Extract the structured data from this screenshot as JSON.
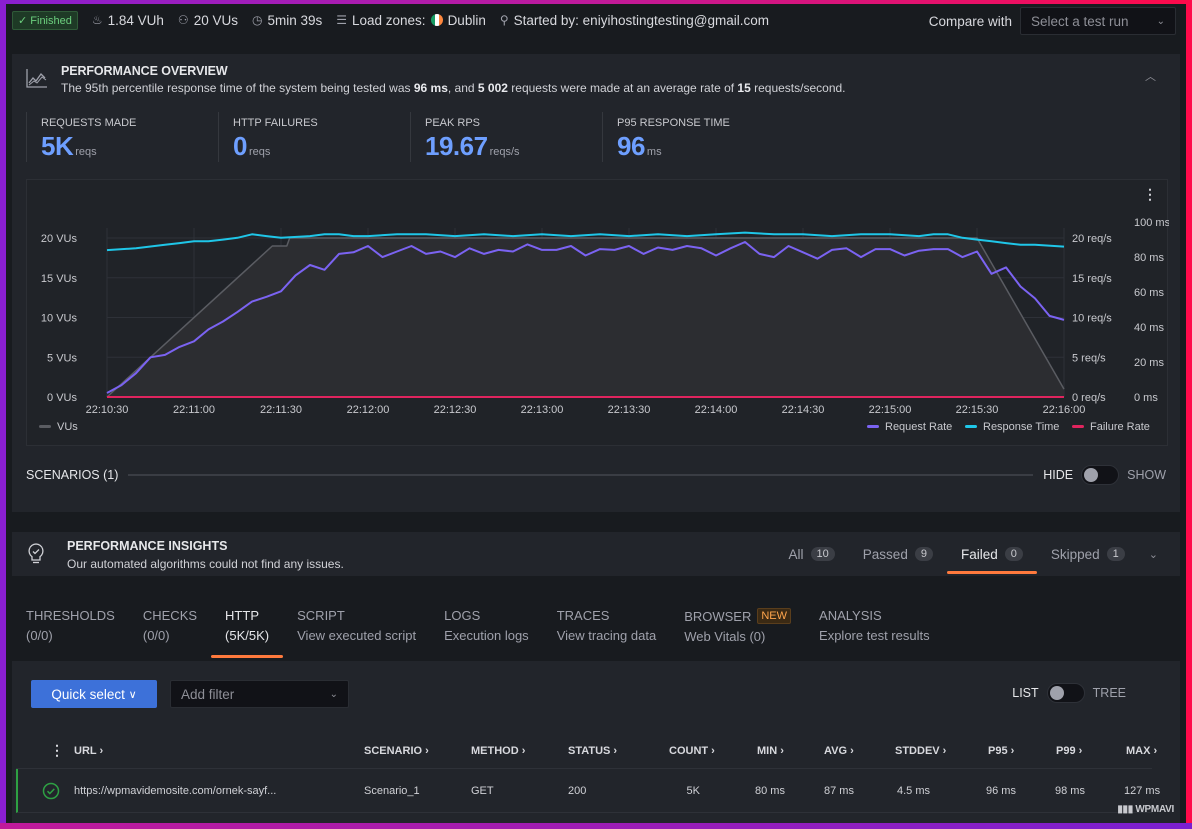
{
  "topbar": {
    "status": "Finished",
    "vuh": "1.84 VUh",
    "vus": "20 VUs",
    "duration": "5min 39s",
    "load_zones_label": "Load zones:",
    "load_zone": "Dublin",
    "started_by": "Started by: eniyihostingtesting@gmail.com",
    "compare_label": "Compare with",
    "compare_placeholder": "Select a test run"
  },
  "overview": {
    "title": "PERFORMANCE OVERVIEW",
    "desc_pre": "The 95th percentile response time of the system being tested was ",
    "desc_p95": "96 ms",
    "desc_mid": ", and ",
    "desc_requests": "5 002",
    "desc_mid2": " requests were made at an average rate of ",
    "desc_rate": "15",
    "desc_post": " requests/second.",
    "stats": [
      {
        "label": "REQUESTS MADE",
        "value": "5K",
        "unit": "reqs"
      },
      {
        "label": "HTTP FAILURES",
        "value": "0",
        "unit": "reqs"
      },
      {
        "label": "PEAK RPS",
        "value": "19.67",
        "unit": "reqs/s"
      },
      {
        "label": "P95 RESPONSE TIME",
        "value": "96",
        "unit": "ms"
      }
    ]
  },
  "chart_data": {
    "type": "line",
    "title": "",
    "x_ticks": [
      "22:10:30",
      "22:11:00",
      "22:11:30",
      "22:12:00",
      "22:12:30",
      "22:13:00",
      "22:13:30",
      "22:14:00",
      "22:14:30",
      "22:15:00",
      "22:15:30",
      "22:16:00"
    ],
    "x_range_seconds": [
      0,
      330
    ],
    "y_left": {
      "label": "VUs",
      "ticks": [
        "0 VUs",
        "5 VUs",
        "10 VUs",
        "15 VUs",
        "20 VUs"
      ],
      "range": [
        0,
        20
      ]
    },
    "y_right_rps": {
      "ticks": [
        "0 req/s",
        "5 req/s",
        "10 req/s",
        "15 req/s",
        "20 req/s"
      ],
      "range": [
        0,
        20
      ]
    },
    "y_right_ms": {
      "ticks": [
        "0 ms",
        "20 ms",
        "40 ms",
        "60 ms",
        "80 ms",
        "100 ms"
      ],
      "range": [
        0,
        100
      ]
    },
    "grid": true,
    "legend_left": [
      "VUs"
    ],
    "legend_right": [
      "Request Rate",
      "Response Time",
      "Failure Rate"
    ],
    "colors": {
      "vus": "#5a5c62",
      "request_rate": "#7b63f2",
      "response_time": "#1fc6e8",
      "failure_rate": "#e0245e"
    },
    "series": [
      {
        "name": "VUs",
        "axis": "vus",
        "x": [
          0,
          57,
          62,
          63,
          300,
          330
        ],
        "values": [
          0,
          19,
          19,
          20,
          20,
          1
        ]
      },
      {
        "name": "Request Rate",
        "axis": "rps",
        "x": [
          0,
          5,
          10,
          15,
          20,
          25,
          30,
          35,
          40,
          45,
          50,
          55,
          60,
          65,
          70,
          75,
          80,
          85,
          90,
          95,
          100,
          105,
          110,
          115,
          120,
          125,
          130,
          135,
          140,
          145,
          150,
          155,
          160,
          165,
          170,
          175,
          180,
          185,
          190,
          195,
          200,
          205,
          210,
          215,
          220,
          225,
          230,
          235,
          240,
          245,
          250,
          255,
          260,
          265,
          270,
          275,
          280,
          285,
          290,
          295,
          300,
          305,
          310,
          315,
          320,
          325,
          330
        ],
        "values": [
          0.5,
          1.5,
          3,
          5,
          5.3,
          6.3,
          7,
          8.5,
          9.5,
          10.7,
          12,
          12.6,
          13.3,
          15.3,
          16.6,
          16,
          18,
          18.2,
          19,
          17.6,
          18.3,
          19,
          18,
          18.3,
          17.6,
          18.7,
          18,
          18.5,
          18.3,
          19.2,
          18.5,
          18.5,
          19,
          17.8,
          18.6,
          18.5,
          19,
          18,
          18.8,
          18.5,
          19,
          18.7,
          17.8,
          18.7,
          19.5,
          18,
          17.6,
          19,
          18.2,
          17.4,
          18.5,
          18.7,
          17.6,
          18.6,
          18.6,
          17.8,
          18.4,
          18.6,
          18.6,
          17.6,
          18.3,
          15.5,
          16.3,
          13.9,
          12.4,
          10.2,
          9.7,
          7.9,
          5.9,
          4.2,
          2.2,
          1
        ]
      },
      {
        "name": "Response Time",
        "axis": "ms",
        "x": [
          0,
          10,
          20,
          25,
          30,
          35,
          40,
          45,
          50,
          55,
          60,
          70,
          75,
          80,
          85,
          90,
          100,
          110,
          120,
          130,
          140,
          150,
          160,
          170,
          180,
          190,
          200,
          210,
          220,
          230,
          240,
          250,
          260,
          270,
          280,
          285,
          290,
          295,
          300,
          305,
          310,
          315,
          320,
          330
        ],
        "values": [
          84,
          85,
          87,
          88,
          89,
          89,
          90,
          91,
          93,
          92,
          91,
          92,
          93,
          93,
          92,
          92,
          93,
          93,
          92,
          93,
          92,
          93,
          92,
          93,
          92,
          93,
          92,
          93,
          94,
          93,
          93,
          92,
          93,
          93,
          92,
          93,
          93,
          91,
          90,
          89,
          88,
          87,
          87,
          86
        ]
      },
      {
        "name": "Failure Rate",
        "axis": "rps",
        "x": [
          0,
          330
        ],
        "values": [
          0,
          0
        ]
      }
    ]
  },
  "scenarios": {
    "label": "SCENARIOS (1)",
    "hide": "HIDE",
    "show": "SHOW"
  },
  "insights": {
    "title": "PERFORMANCE INSIGHTS",
    "desc": "Our automated algorithms could not find any issues.",
    "tabs": [
      {
        "label": "All",
        "count": "10"
      },
      {
        "label": "Passed",
        "count": "9"
      },
      {
        "label": "Failed",
        "count": "0",
        "active": true
      },
      {
        "label": "Skipped",
        "count": "1"
      }
    ]
  },
  "main_tabs": [
    {
      "title": "THRESHOLDS",
      "sub": "(0/0)"
    },
    {
      "title": "CHECKS",
      "sub": "(0/0)"
    },
    {
      "title": "HTTP",
      "sub": "(5K/5K)",
      "active": true
    },
    {
      "title": "SCRIPT",
      "sub": "View executed script"
    },
    {
      "title": "LOGS",
      "sub": "Execution logs"
    },
    {
      "title": "TRACES",
      "sub": "View tracing data"
    },
    {
      "title": "BROWSER",
      "sub": "Web Vitals (0)",
      "badge": "NEW"
    },
    {
      "title": "ANALYSIS",
      "sub": "Explore test results"
    }
  ],
  "toolbar": {
    "quick_select": "Quick select",
    "add_filter": "Add filter",
    "list": "LIST",
    "tree": "TREE"
  },
  "table": {
    "headers": [
      "URL",
      "SCENARIO",
      "METHOD",
      "STATUS",
      "COUNT",
      "MIN",
      "AVG",
      "STDDEV",
      "P95",
      "P99",
      "MAX"
    ],
    "rows": [
      {
        "url": "https://wpmavidemosite.com/ornek-sayf...",
        "scenario": "Scenario_1",
        "method": "GET",
        "status": "200",
        "count": "5K",
        "min": "80 ms",
        "avg": "87 ms",
        "stddev": "4.5 ms",
        "p95": "96 ms",
        "p99": "98 ms",
        "max": "127 ms"
      }
    ]
  },
  "watermark": "WPMAVI"
}
